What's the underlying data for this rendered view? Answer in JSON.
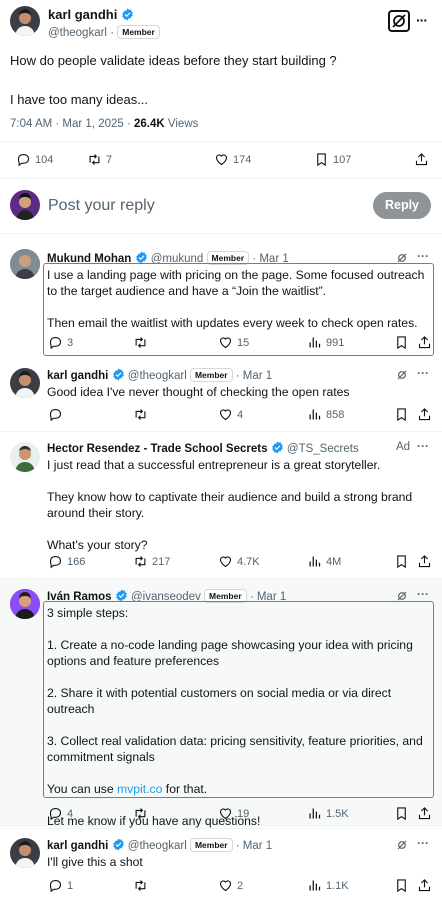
{
  "main_post": {
    "author_name": "karl gandhi",
    "handle": "@theogkarl",
    "separator": "·",
    "badge": "Member",
    "text_line1": "How do people validate ideas before they start building ?",
    "text_line2": "I have too many ideas...",
    "time": "7:04 AM · Mar 1, 2025 ·",
    "views_count": "26.4K",
    "views_label": "Views",
    "stats": {
      "replies": "104",
      "reposts": "7",
      "likes": "174",
      "bookmarks": "107"
    }
  },
  "composer": {
    "placeholder": "Post your reply",
    "button": "Reply"
  },
  "replies": [
    {
      "name": "Mukund Mohan",
      "handle": "@mukund",
      "badge": "Member",
      "date": "· Mar 1",
      "paragraphs": [
        "I use a landing page with pricing on the page. Some focused outreach to the target audience and have a “Join the waitlist”.",
        "Then email the waitlist with updates every week to check open rates."
      ],
      "stats": {
        "replies": "3",
        "reposts": "",
        "likes": "15",
        "views": "991"
      }
    },
    {
      "name": "karl gandhi",
      "handle": "@theogkarl",
      "badge": "Member",
      "date": "· Mar 1",
      "paragraphs": [
        "Good idea I've never thought of checking the open rates"
      ],
      "stats": {
        "replies": "",
        "reposts": "",
        "likes": "4",
        "views": "858"
      }
    },
    {
      "name": "Hector Resendez - Trade School Secrets",
      "handle": "@TS_Secrets",
      "badge": "",
      "date": "Ad",
      "paragraphs": [
        "I just read that a successful entrepreneur is a great storyteller.",
        "They know how to captivate their audience and build a strong brand around their story.",
        "What's your story?"
      ],
      "stats": {
        "replies": "166",
        "reposts": "217",
        "likes": "4.7K",
        "views": "4M"
      }
    },
    {
      "name": "Iván Ramos",
      "handle": "@ivanseodev",
      "badge": "Member",
      "date": "· Mar 1",
      "paragraphs": [
        "3 simple steps:",
        "1. Create a no-code landing page showcasing your idea with pricing options and feature preferences",
        "2. Share it with potential customers on social media or via direct outreach",
        "3. Collect real validation data: pricing sensitivity, feature priorities, and commitment signals"
      ],
      "link_prefix": "You can use ",
      "link_text": "mvpit.co",
      "link_suffix": " for that.",
      "closing": "Let me know if you have any questions!",
      "stats": {
        "replies": "4",
        "reposts": "",
        "likes": "19",
        "views": "1.5K"
      }
    },
    {
      "name": "karl gandhi",
      "handle": "@theogkarl",
      "badge": "Member",
      "date": "· Mar 1",
      "paragraphs": [
        "I'll give this a shot"
      ],
      "stats": {
        "replies": "1",
        "reposts": "",
        "likes": "2",
        "views": "1.1K"
      }
    }
  ],
  "more_label": "···",
  "colors": {
    "accent": "#1d9bf0",
    "highlight": "#e0563b",
    "muted": "#536471"
  }
}
